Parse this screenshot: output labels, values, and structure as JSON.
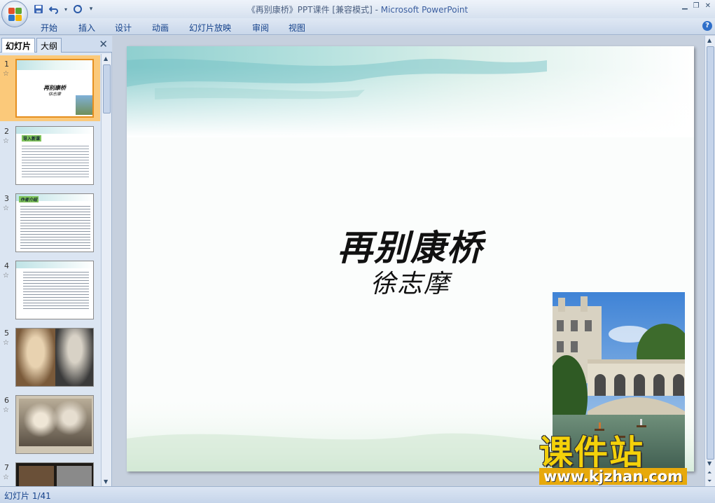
{
  "window": {
    "title_doc": "《再别康桥》PPT课件 [兼容模式]",
    "title_sep": " - ",
    "title_app": "Microsoft PowerPoint"
  },
  "ribbon": {
    "tabs": [
      "开始",
      "插入",
      "设计",
      "动画",
      "幻灯片放映",
      "审阅",
      "视图"
    ]
  },
  "panel": {
    "tab_slides": "幻灯片",
    "tab_outline": "大纲",
    "thumbnails": [
      {
        "num": "1",
        "star": "☆",
        "title": "再别康桥",
        "sub": "徐志摩"
      },
      {
        "num": "2",
        "star": "☆",
        "heading": "导入新课"
      },
      {
        "num": "3",
        "star": "☆",
        "heading": "作者介绍"
      },
      {
        "num": "4",
        "star": "☆"
      },
      {
        "num": "5",
        "star": "☆"
      },
      {
        "num": "6",
        "star": "☆"
      },
      {
        "num": "7",
        "star": "☆"
      }
    ]
  },
  "slide": {
    "title": "再别康桥",
    "subtitle": "徐志摩"
  },
  "watermark": {
    "main": "课件站",
    "url": "www.kjzhan.com"
  },
  "status": {
    "slide_counter": "幻灯片 1/41"
  },
  "colors": {
    "accent": "#15428b",
    "selected_thumb": "#fbc97a",
    "watermark_yellow": "#f4d10a"
  }
}
